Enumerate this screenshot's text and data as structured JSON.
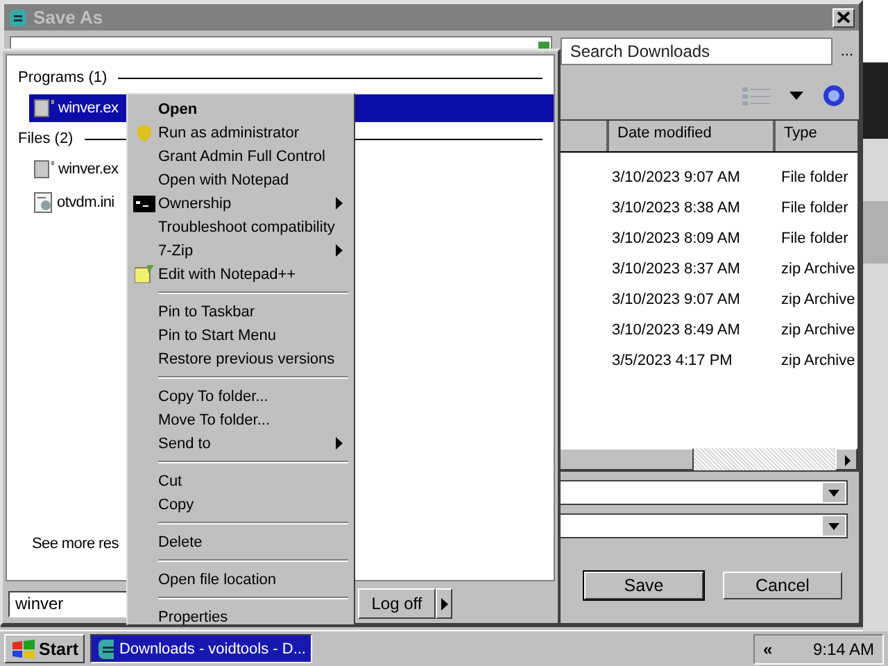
{
  "dialog": {
    "title": "Save As",
    "search": {
      "placeholder": "Search Downloads"
    },
    "more_button": "...",
    "columns": [
      "Date modified",
      "Type"
    ],
    "rows": [
      {
        "date": "3/10/2023 9:07 AM",
        "type": "File folder"
      },
      {
        "date": "3/10/2023 8:38 AM",
        "type": "File folder"
      },
      {
        "date": "3/10/2023 8:09 AM",
        "type": "File folder"
      },
      {
        "date": "3/10/2023 8:37 AM",
        "type": "zip Archive"
      },
      {
        "date": "3/10/2023 9:07 AM",
        "type": "zip Archive"
      },
      {
        "date": "3/10/2023 8:49 AM",
        "type": "zip Archive"
      },
      {
        "date": "3/5/2023 4:17 PM",
        "type": "zip Archive"
      }
    ],
    "save_button": "Save",
    "cancel_button": "Cancel"
  },
  "start_menu": {
    "groups": [
      {
        "title": "Programs (1)",
        "items": [
          {
            "name": "winver.ex",
            "selected": true
          }
        ]
      },
      {
        "title": "Files (2)",
        "items": [
          {
            "name": "winver.ex",
            "selected": false
          },
          {
            "name": "otvdm.ini",
            "selected": false
          }
        ]
      }
    ],
    "see_more": "See more res",
    "search": {
      "value": "winver"
    },
    "log_off": "Log off"
  },
  "context_menu": [
    {
      "kind": "item",
      "label": "Open",
      "default": true,
      "submenu": false
    },
    {
      "kind": "item",
      "label": "Run as administrator",
      "default": false,
      "submenu": false
    },
    {
      "kind": "item",
      "label": "Grant Admin Full Control",
      "default": false,
      "submenu": false
    },
    {
      "kind": "item",
      "label": "Open with Notepad",
      "default": false,
      "submenu": false
    },
    {
      "kind": "item",
      "label": "Ownership",
      "default": false,
      "submenu": true
    },
    {
      "kind": "item",
      "label": "Troubleshoot compatibility",
      "default": false,
      "submenu": false
    },
    {
      "kind": "item",
      "label": "7-Zip",
      "default": false,
      "submenu": true
    },
    {
      "kind": "item",
      "label": "Edit with Notepad++",
      "default": false,
      "submenu": false
    },
    {
      "kind": "separator"
    },
    {
      "kind": "item",
      "label": "Pin to Taskbar",
      "default": false,
      "submenu": false
    },
    {
      "kind": "item",
      "label": "Pin to Start Menu",
      "default": false,
      "submenu": false
    },
    {
      "kind": "item",
      "label": "Restore previous versions",
      "default": false,
      "submenu": false
    },
    {
      "kind": "separator"
    },
    {
      "kind": "item",
      "label": "Copy To folder...",
      "default": false,
      "submenu": false
    },
    {
      "kind": "item",
      "label": "Move To folder...",
      "default": false,
      "submenu": false
    },
    {
      "kind": "item",
      "label": "Send to",
      "default": false,
      "submenu": true
    },
    {
      "kind": "separator"
    },
    {
      "kind": "item",
      "label": "Cut",
      "default": false,
      "submenu": false
    },
    {
      "kind": "item",
      "label": "Copy",
      "default": false,
      "submenu": false
    },
    {
      "kind": "separator"
    },
    {
      "kind": "item",
      "label": "Delete",
      "default": false,
      "submenu": false
    },
    {
      "kind": "separator"
    },
    {
      "kind": "item",
      "label": "Open file location",
      "default": false,
      "submenu": false
    },
    {
      "kind": "separator"
    },
    {
      "kind": "item",
      "label": "Properties",
      "default": false,
      "submenu": false
    }
  ],
  "taskbar": {
    "start": "Start",
    "tasks": [
      {
        "label": "Downloads - voidtools - D...",
        "selected": true
      }
    ],
    "tray_toggle": "«",
    "clock": "9:14 AM"
  }
}
